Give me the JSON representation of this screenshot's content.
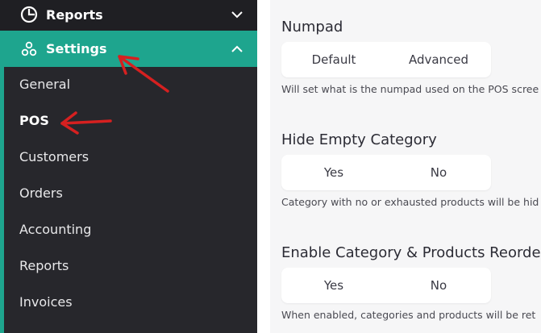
{
  "sidebar": {
    "reports_label": "Reports",
    "settings_label": "Settings",
    "submenu": [
      "General",
      "POS",
      "Customers",
      "Orders",
      "Accounting",
      "Reports",
      "Invoices"
    ]
  },
  "sections": [
    {
      "title": "Numpad",
      "options": [
        "Default",
        "Advanced"
      ],
      "help": "Will set what is the numpad used on the POS scree"
    },
    {
      "title": "Hide Empty Category",
      "options": [
        "Yes",
        "No"
      ],
      "help": "Category with no or exhausted products will be hid"
    },
    {
      "title": "Enable Category & Products Reorder",
      "options": [
        "Yes",
        "No"
      ],
      "help": "When enabled, categories and products will be ret"
    }
  ],
  "colors": {
    "accent": "#1ea58e",
    "sidebar_bg": "#1f1f23",
    "annotation": "#d62020"
  }
}
